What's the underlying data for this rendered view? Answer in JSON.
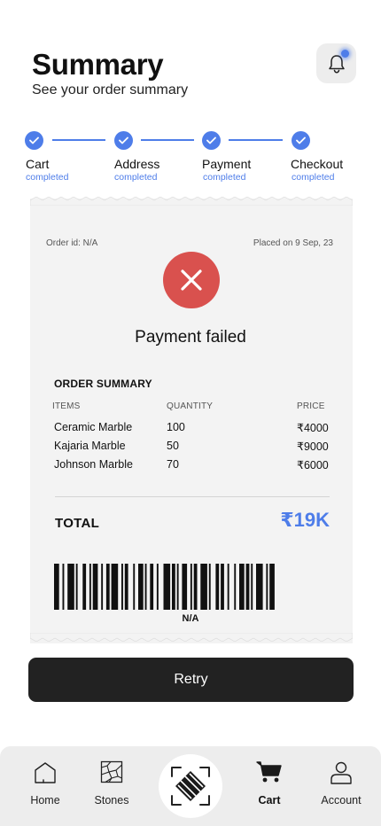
{
  "header": {
    "title": "Summary",
    "subtitle": "See your order summary",
    "notification_icon": "bell-icon",
    "accent": "#4e7de9"
  },
  "steps": [
    {
      "label": "Cart",
      "status": "completed"
    },
    {
      "label": "Address",
      "status": "completed"
    },
    {
      "label": "Payment",
      "status": "completed"
    },
    {
      "label": "Checkout",
      "status": "completed"
    }
  ],
  "receipt": {
    "order_id": "Order id: N/A",
    "placed_on": "Placed on 9 Sep, 23",
    "status_icon": "close-icon",
    "status_color": "#d9514e",
    "status_title": "Payment failed",
    "summary_title": "ORDER SUMMARY",
    "columns": {
      "items": "ITEMS",
      "quantity": "QUANTITY",
      "price": "PRICE"
    },
    "items": [
      {
        "name": "Ceramic Marble",
        "quantity": "100",
        "price": "₹4000"
      },
      {
        "name": "Kajaria Marble",
        "quantity": "50",
        "price": "₹9000"
      },
      {
        "name": "Johnson Marble",
        "quantity": "70",
        "price": "₹6000"
      }
    ],
    "total_label": "TOTAL",
    "total_value": "₹19K",
    "barcode_text": "N/A"
  },
  "actions": {
    "retry_label": "Retry"
  },
  "nav": {
    "items": [
      {
        "label": "Home",
        "icon": "home-icon",
        "active": false
      },
      {
        "label": "Stones",
        "icon": "stones-icon",
        "active": false
      },
      {
        "label": "Cart",
        "icon": "cart-icon",
        "active": true
      },
      {
        "label": "Account",
        "icon": "account-icon",
        "active": false
      }
    ],
    "center_icon": "scan-icon"
  }
}
